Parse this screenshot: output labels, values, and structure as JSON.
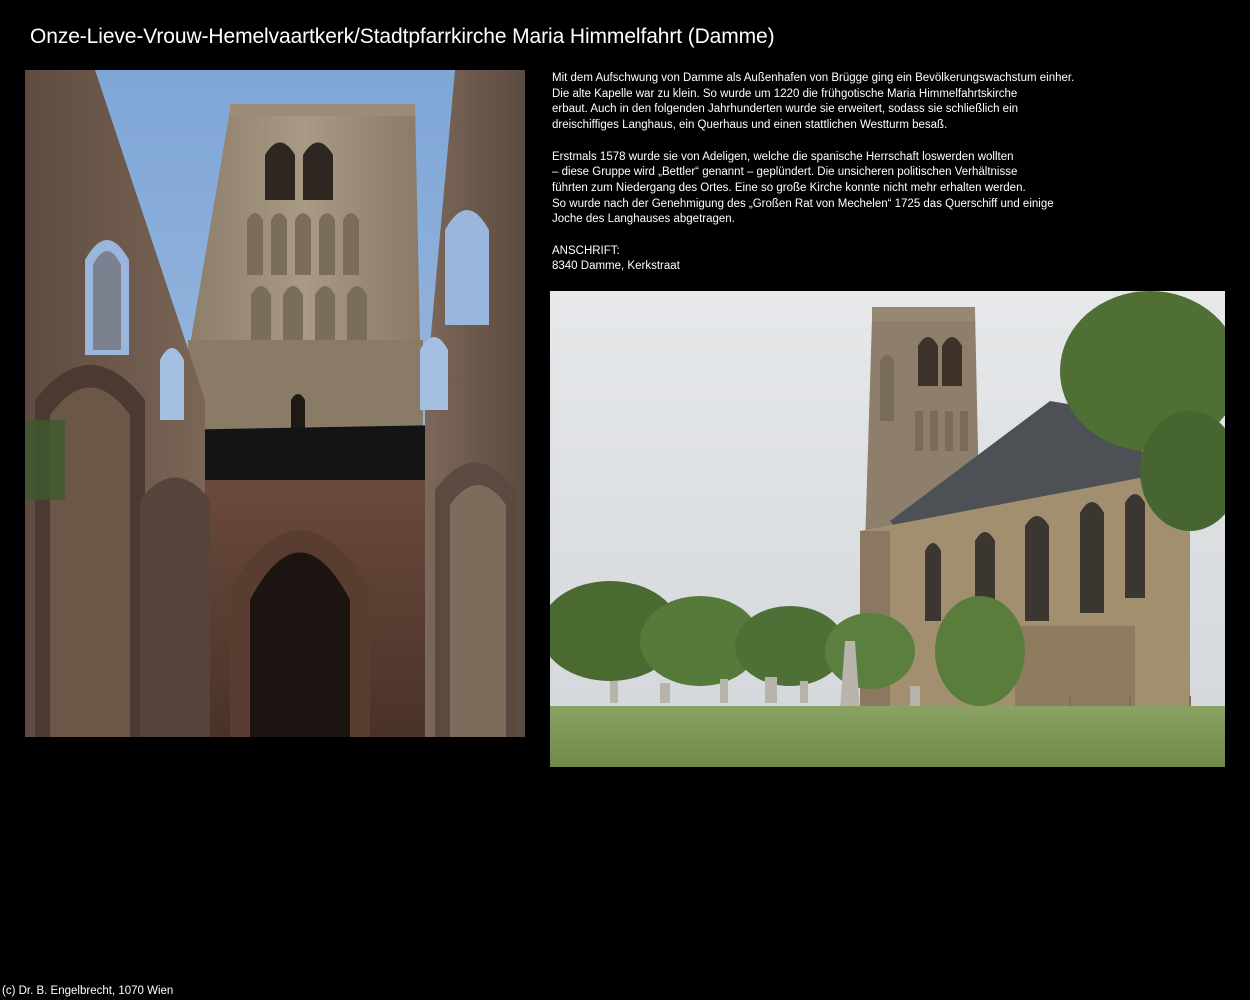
{
  "page": {
    "title": "Onze-Lieve-Vrouw-Hemelvaartkerk/Stadtpfarrkirche Maria Himmelfahrt (Damme)",
    "background": "#000000",
    "text_color": "#ffffff"
  },
  "description": {
    "paragraph1": [
      "Mit dem Aufschwung von Damme als Außenhafen von Brügge ging ein Bevölkerungswachstum einher.",
      "Die alte Kapelle war zu klein. So wurde um 1220 die frühgotische Maria Himmelfahrtskirche",
      "erbaut. Auch in den folgenden Jahrhunderten wurde sie erweitert, sodass sie schließlich ein",
      "dreischiffiges Langhaus, ein Querhaus und einen stattlichen Westturm besaß."
    ],
    "paragraph2": [
      "Erstmals 1578 wurde sie von Adeligen, welche die spanische Herrschaft loswerden wollten",
      "– diese Gruppe wird „Bettler“ genannt – geplündert. Die unsicheren politischen Verhältnisse",
      "führten zum Niedergang des Ortes. Eine so große Kirche konnte nicht mehr erhalten werden.",
      "So wurde nach der Genehmigung des „Großen Rat von Mechelen“ 1725 das Querschiff und einige",
      "Joche des Langhauses abgetragen."
    ],
    "address": [
      "ANSCHRIFT:",
      "8340 Damme, Kerkstraat"
    ]
  },
  "footer": {
    "copyright": "(c) Dr. B. Engelbrecht, 1070 Wien"
  }
}
